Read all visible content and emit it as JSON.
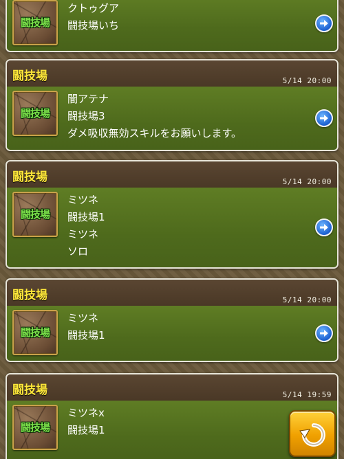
{
  "section_label": "闘技場",
  "cards": [
    {
      "title": "",
      "time": "",
      "lines": [
        "クトゥグア",
        "闘技場いち"
      ]
    },
    {
      "title": "闘技場",
      "time": "5/14 20:00",
      "lines": [
        "闇アテナ",
        "闘技場3",
        "ダメ吸収無効スキルをお願いします。"
      ]
    },
    {
      "title": "闘技場",
      "time": "5/14 20:00",
      "lines": [
        "ミツネ",
        "闘技場1",
        "ミツネ",
        "ソロ"
      ]
    },
    {
      "title": "闘技場",
      "time": "5/14 20:00",
      "lines": [
        "ミツネ",
        "闘技場1"
      ]
    },
    {
      "title": "闘技場",
      "time": "5/14 19:59",
      "lines": [
        "ミツネx",
        "闘技場1"
      ]
    }
  ],
  "icons": {
    "go": "arrow-right-circle-icon",
    "refresh": "refresh-icon"
  },
  "colors": {
    "title": "#ffe83a",
    "body": "#5a7822",
    "header": "#4e3c2a",
    "go_button": "#1a5fd0",
    "refresh_button": "#f0a000"
  }
}
